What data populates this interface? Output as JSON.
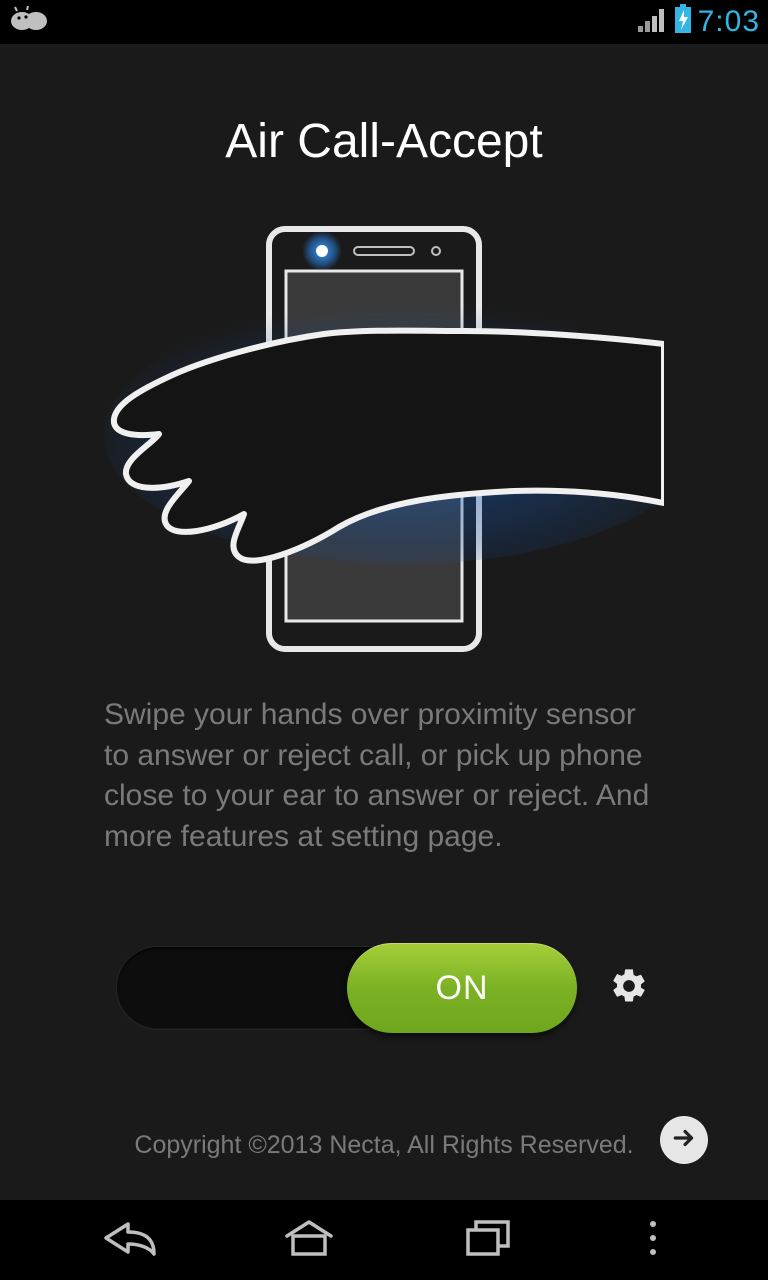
{
  "status": {
    "time": "7:03"
  },
  "main": {
    "title": "Air Call-Accept",
    "description": "Swipe your hands over proximity sensor to answer or reject call, or pick up phone close to your ear to answer or reject. And more features at setting page.",
    "toggle_label": "ON",
    "copyright": "Copyright ©2013 Necta, All Rights Reserved."
  }
}
